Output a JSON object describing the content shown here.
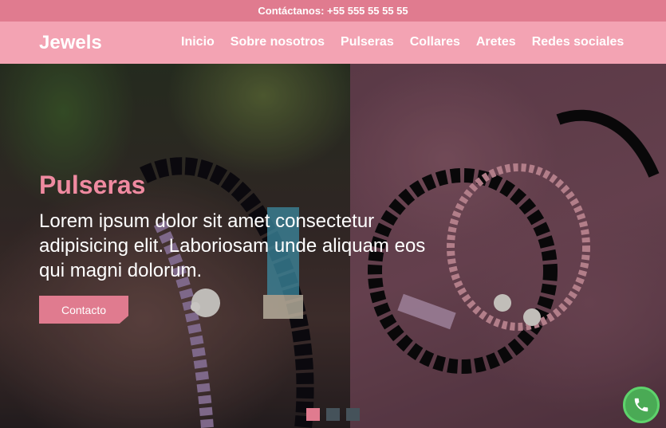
{
  "topbar": {
    "contact_text": "Contáctanos: +55 555 55 55 55"
  },
  "navbar": {
    "brand": "Jewels",
    "links": [
      {
        "label": "Inicio"
      },
      {
        "label": "Sobre nosotros"
      },
      {
        "label": "Pulseras"
      },
      {
        "label": "Collares"
      },
      {
        "label": "Aretes"
      },
      {
        "label": "Redes sociales"
      }
    ]
  },
  "hero": {
    "title": "Pulseras",
    "text": "Lorem ipsum dolor sit amet consectetur adipisicing elit. Laboriosam unde aliquam eos qui magni dolorum.",
    "button_label": "Contacto",
    "slides": {
      "count": 3,
      "active": 1
    }
  },
  "call_button": {
    "icon": "phone-icon"
  },
  "colors": {
    "accent": "#e07b8f",
    "nav_bg": "#f3a3b3",
    "title_pink": "#ef8aa0",
    "call_green": "#4aaa55"
  }
}
